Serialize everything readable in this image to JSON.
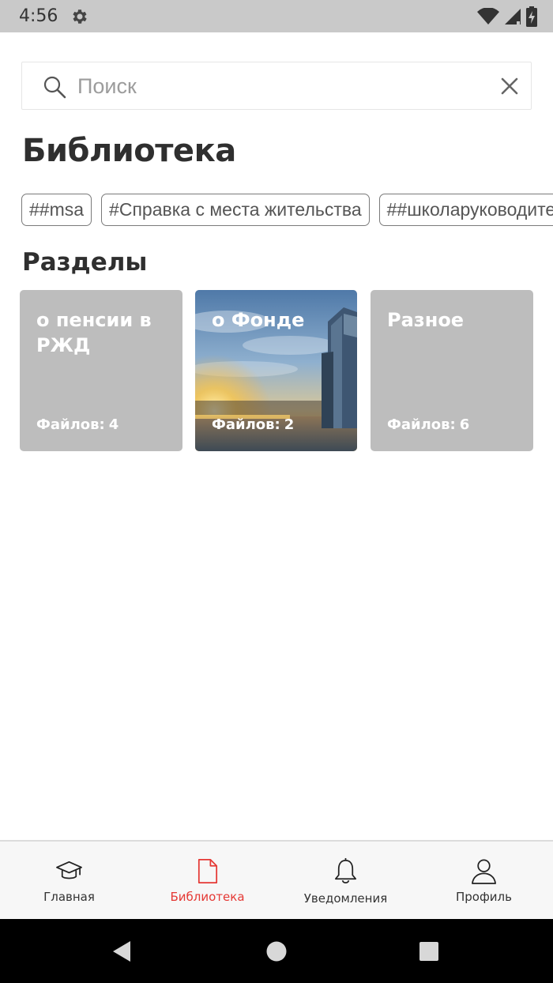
{
  "status_bar": {
    "time": "4:56",
    "icons": [
      "gear-icon",
      "wifi-icon",
      "signal-icon",
      "battery-icon"
    ]
  },
  "search": {
    "placeholder": "Поиск",
    "value": ""
  },
  "page": {
    "title": "Библиотека",
    "sections_title": "Разделы"
  },
  "tags": [
    "##msa",
    "#Справка с места жительства",
    "##школаруководителя"
  ],
  "sections": [
    {
      "title": "о пенсии в РЖД",
      "files_label": "Файлов:",
      "files_count": "4"
    },
    {
      "title": "о Фонде",
      "files_label": "Файлов:",
      "files_count": "2"
    },
    {
      "title": "Разное",
      "files_label": "Файлов:",
      "files_count": "6"
    }
  ],
  "bottom_nav": {
    "items": [
      {
        "label": "Главная",
        "icon": "graduation-cap-icon"
      },
      {
        "label": "Библиотека",
        "icon": "document-icon",
        "active": true
      },
      {
        "label": "Уведомления",
        "icon": "bell-icon"
      },
      {
        "label": "Профиль",
        "icon": "user-icon"
      }
    ]
  },
  "colors": {
    "accent": "#e53935",
    "card_bg": "#bdbdbd",
    "status_bar": "#c9c9c9"
  }
}
